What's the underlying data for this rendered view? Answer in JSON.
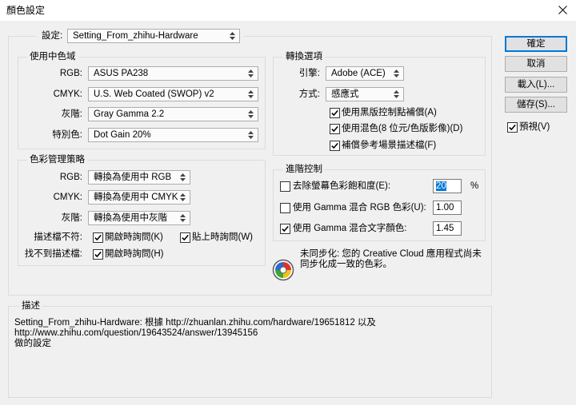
{
  "window": {
    "title": "顏色設定"
  },
  "icons": {
    "close": "close-icon",
    "dropdown": "updown-arrow-icon",
    "check": "checkmark-icon",
    "sync_status": "color-sync-icon"
  },
  "colors": {
    "accent": "#0078d7",
    "selection": "#0078d7",
    "dialog_bg": "#f0f0f0",
    "titlebar_bg": "#ffffff"
  },
  "settings": {
    "label": "設定:",
    "value": "Setting_From_zhihu-Hardware"
  },
  "working_spaces": {
    "title": "使用中色域",
    "rgb": {
      "label": "RGB:",
      "value": "ASUS PA238"
    },
    "cmyk": {
      "label": "CMYK:",
      "value": "U.S. Web Coated (SWOP) v2"
    },
    "gray": {
      "label": "灰階:",
      "value": "Gray Gamma 2.2"
    },
    "spot": {
      "label": "特別色:",
      "value": "Dot Gain 20%"
    }
  },
  "policies": {
    "title": "色彩管理策略",
    "rgb": {
      "label": "RGB:",
      "value": "轉換為使用中 RGB"
    },
    "cmyk": {
      "label": "CMYK:",
      "value": "轉換為使用中 CMYK"
    },
    "gray": {
      "label": "灰階:",
      "value": "轉換為使用中灰階"
    },
    "mismatch": {
      "label": "描述檔不符:",
      "ask_open": {
        "label": "開啟時詢問(K)",
        "checked": true
      },
      "ask_paste": {
        "label": "貼上時詢問(W)",
        "checked": true
      }
    },
    "missing": {
      "label": "找不到描述檔:",
      "ask_open": {
        "label": "開啟時詢問(H)",
        "checked": true
      }
    }
  },
  "conversion": {
    "title": "轉換選項",
    "engine": {
      "label": "引擎:",
      "value": "Adobe (ACE)"
    },
    "intent": {
      "label": "方式:",
      "value": "感應式"
    },
    "black_point": {
      "label": "使用黑版控制點補償(A)",
      "checked": true
    },
    "dither": {
      "label": "使用混色(8 位元/色版影像)(D)",
      "checked": true
    },
    "scene_referred": {
      "label": "補償參考場景描述檔(F)",
      "checked": true
    }
  },
  "advanced": {
    "title": "進階控制",
    "desaturate": {
      "label": "去除螢幕色彩飽和度(E):",
      "checked": false,
      "value": "20",
      "unit": "%"
    },
    "blend_rgb": {
      "label": "使用 Gamma 混合 RGB 色彩(U):",
      "checked": false,
      "value": "1.00"
    },
    "blend_text": {
      "label": "使用 Gamma 混合文字顏色:",
      "checked": true,
      "value": "1.45"
    }
  },
  "sync": {
    "lines": [
      "未同步化: 您的 Creative Cloud 應用程式尚未",
      "同步化成一致的色彩。"
    ]
  },
  "description": {
    "title": "描述",
    "lines": [
      "Setting_From_zhihu-Hardware: 根據 http://zhuanlan.zhihu.com/hardware/19651812 以及",
      "http://www.zhihu.com/question/19643524/answer/13945156",
      "做的設定"
    ]
  },
  "buttons": {
    "ok": "確定",
    "cancel": "取消",
    "load": "載入(L)...",
    "save": "儲存(S)..."
  },
  "preview": {
    "label": "預視(V)",
    "checked": true
  }
}
